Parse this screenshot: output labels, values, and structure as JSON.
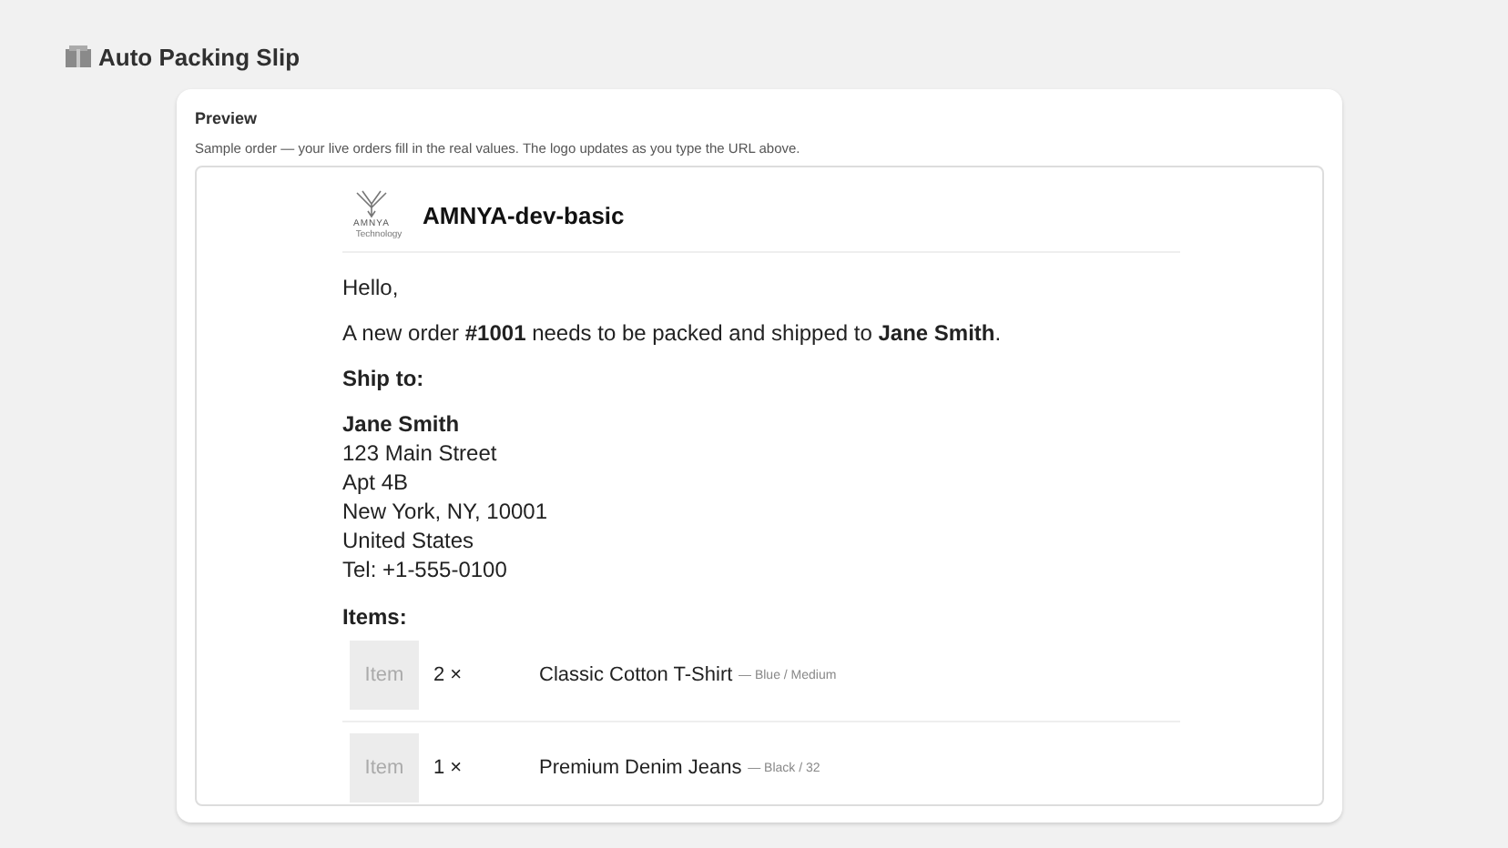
{
  "page": {
    "title": "Auto Packing Slip"
  },
  "preview": {
    "heading": "Preview",
    "description": "Sample order — your live orders fill in the real values. The logo updates as you type the URL above.",
    "logo": {
      "name": "AMNYA",
      "tagline": "Technology"
    },
    "shop_name": "AMNYA-dev-basic",
    "greeting": "Hello,",
    "intro": "A new order **#1001** needs to be packed and shipped to **Jane Smith**.",
    "ship_to_label": "Ship to:",
    "address": [
      "Jane Smith",
      "123 Main Street",
      "Apt 4B",
      "New York, NY, 10001",
      "United States",
      "Tel: +1-555-0100"
    ],
    "items_label": "Items:",
    "items": [
      {
        "thumb": "Item",
        "qty": "2 ×",
        "name": "Classic Cotton T-Shirt",
        "variant": "— Blue / Medium"
      },
      {
        "thumb": "Item",
        "qty": "1 ×",
        "name": "Premium Denim Jeans",
        "variant": "— Black / 32"
      }
    ]
  }
}
